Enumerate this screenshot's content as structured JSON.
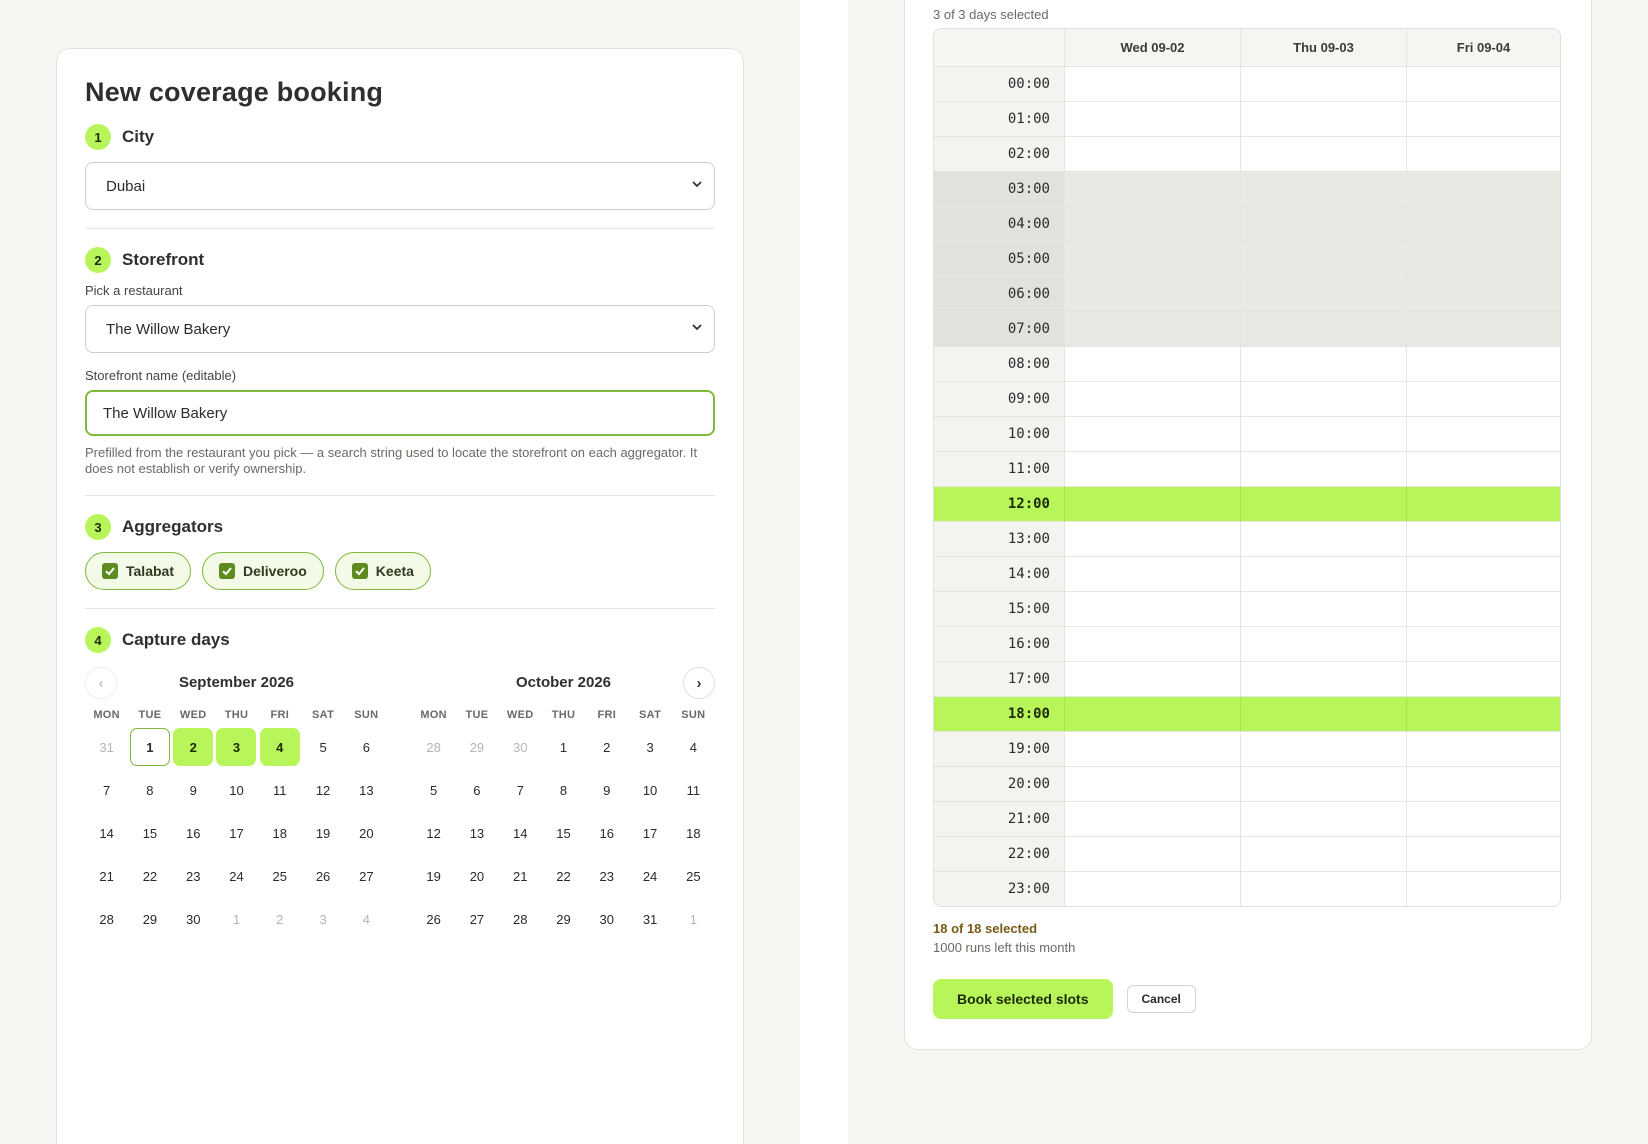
{
  "form": {
    "title": "New coverage booking",
    "steps": {
      "city": {
        "num": "1",
        "title": "City",
        "value": "Dubai"
      },
      "storefront": {
        "num": "2",
        "title": "Storefront",
        "pick_label": "Pick a restaurant",
        "pick_value": "The Willow Bakery",
        "name_label": "Storefront name (editable)",
        "name_value": "The Willow Bakery",
        "help": "Prefilled from the restaurant you pick — a search string used to locate the storefront on each aggregator. It does not establish or verify ownership."
      },
      "aggregators": {
        "num": "3",
        "title": "Aggregators",
        "items": [
          "Talabat",
          "Deliveroo",
          "Keeta"
        ]
      },
      "days": {
        "num": "4",
        "title": "Capture days"
      }
    },
    "calendar": {
      "prev": "‹",
      "next": "›",
      "dow": [
        "MON",
        "TUE",
        "WED",
        "THU",
        "FRI",
        "SAT",
        "SUN"
      ],
      "months": [
        {
          "title": "September 2026",
          "days": [
            {
              "d": "31",
              "s": "muted"
            },
            {
              "d": "1",
              "s": "today"
            },
            {
              "d": "2",
              "s": "sel"
            },
            {
              "d": "3",
              "s": "sel"
            },
            {
              "d": "4",
              "s": "sel"
            },
            {
              "d": "5"
            },
            {
              "d": "6"
            },
            {
              "d": "7"
            },
            {
              "d": "8"
            },
            {
              "d": "9"
            },
            {
              "d": "10"
            },
            {
              "d": "11"
            },
            {
              "d": "12"
            },
            {
              "d": "13"
            },
            {
              "d": "14"
            },
            {
              "d": "15"
            },
            {
              "d": "16"
            },
            {
              "d": "17"
            },
            {
              "d": "18"
            },
            {
              "d": "19"
            },
            {
              "d": "20"
            },
            {
              "d": "21"
            },
            {
              "d": "22"
            },
            {
              "d": "23"
            },
            {
              "d": "24"
            },
            {
              "d": "25"
            },
            {
              "d": "26"
            },
            {
              "d": "27"
            },
            {
              "d": "28"
            },
            {
              "d": "29"
            },
            {
              "d": "30"
            },
            {
              "d": "1",
              "s": "muted"
            },
            {
              "d": "2",
              "s": "muted"
            },
            {
              "d": "3",
              "s": "muted"
            },
            {
              "d": "4",
              "s": "muted"
            }
          ]
        },
        {
          "title": "October 2026",
          "days": [
            {
              "d": "28",
              "s": "muted"
            },
            {
              "d": "29",
              "s": "muted"
            },
            {
              "d": "30",
              "s": "muted"
            },
            {
              "d": "1"
            },
            {
              "d": "2"
            },
            {
              "d": "3"
            },
            {
              "d": "4"
            },
            {
              "d": "5"
            },
            {
              "d": "6"
            },
            {
              "d": "7"
            },
            {
              "d": "8"
            },
            {
              "d": "9"
            },
            {
              "d": "10"
            },
            {
              "d": "11"
            },
            {
              "d": "12"
            },
            {
              "d": "13"
            },
            {
              "d": "14"
            },
            {
              "d": "15"
            },
            {
              "d": "16"
            },
            {
              "d": "17"
            },
            {
              "d": "18"
            },
            {
              "d": "19"
            },
            {
              "d": "20"
            },
            {
              "d": "21"
            },
            {
              "d": "22"
            },
            {
              "d": "23"
            },
            {
              "d": "24"
            },
            {
              "d": "25"
            },
            {
              "d": "26"
            },
            {
              "d": "27"
            },
            {
              "d": "28"
            },
            {
              "d": "29"
            },
            {
              "d": "30"
            },
            {
              "d": "31"
            },
            {
              "d": "1",
              "s": "muted"
            }
          ]
        }
      ]
    }
  },
  "schedule": {
    "days_selected": "3 of 3 days selected",
    "columns": [
      "Wed 09-02",
      "Thu 09-03",
      "Fri 09-04"
    ],
    "rows": [
      {
        "t": "00:00"
      },
      {
        "t": "01:00"
      },
      {
        "t": "02:00"
      },
      {
        "t": "03:00",
        "s": "night"
      },
      {
        "t": "04:00",
        "s": "night"
      },
      {
        "t": "05:00",
        "s": "night"
      },
      {
        "t": "06:00",
        "s": "night"
      },
      {
        "t": "07:00",
        "s": "night"
      },
      {
        "t": "08:00"
      },
      {
        "t": "09:00"
      },
      {
        "t": "10:00"
      },
      {
        "t": "11:00"
      },
      {
        "t": "12:00",
        "s": "picked"
      },
      {
        "t": "13:00"
      },
      {
        "t": "14:00"
      },
      {
        "t": "15:00"
      },
      {
        "t": "16:00"
      },
      {
        "t": "17:00"
      },
      {
        "t": "18:00",
        "s": "picked"
      },
      {
        "t": "19:00"
      },
      {
        "t": "20:00"
      },
      {
        "t": "21:00"
      },
      {
        "t": "22:00"
      },
      {
        "t": "23:00"
      }
    ],
    "selected_summary": "18 of 18 selected",
    "runs_left": "1000 runs left this month",
    "book_label": "Book selected slots",
    "cancel_label": "Cancel"
  },
  "colors": {
    "accent": "#b8f55a",
    "accent_border": "#7fb83a",
    "warning_text": "#7a5a14"
  }
}
